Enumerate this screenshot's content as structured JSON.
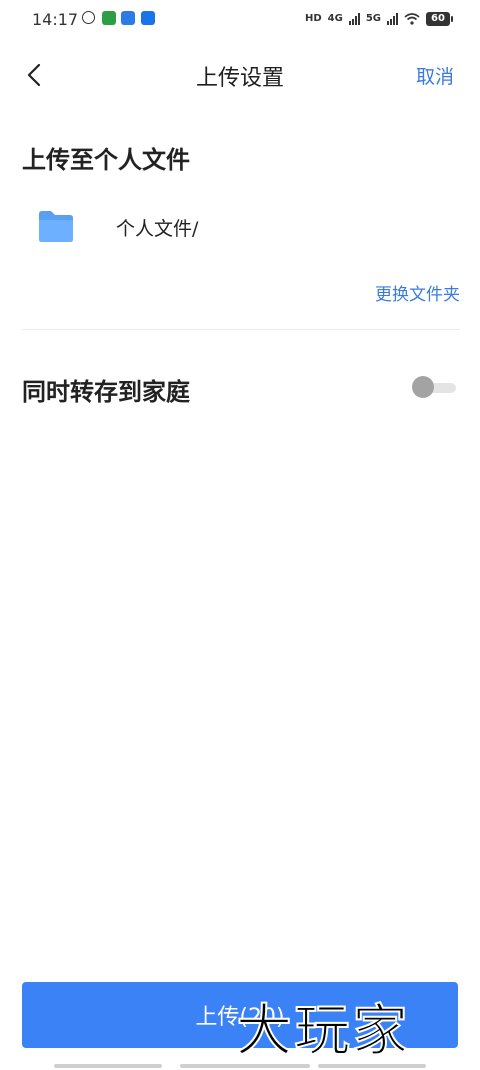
{
  "status_bar": {
    "time": "14:17",
    "hd_label": "HD",
    "net1": "4G",
    "net2": "5G",
    "battery": "60"
  },
  "nav": {
    "title": "上传设置",
    "cancel_label": "取消"
  },
  "upload_target": {
    "section_title": "上传至个人文件",
    "folder_path": "个人文件/",
    "change_folder_label": "更换文件夹"
  },
  "family_option": {
    "label": "同时转存到家庭",
    "enabled": false
  },
  "upload_button": {
    "label": "上传(20)"
  },
  "watermark": "大玩家",
  "colors": {
    "accent": "#3a7be0",
    "button": "#3b82f6",
    "folder": "#5aa0f2"
  }
}
